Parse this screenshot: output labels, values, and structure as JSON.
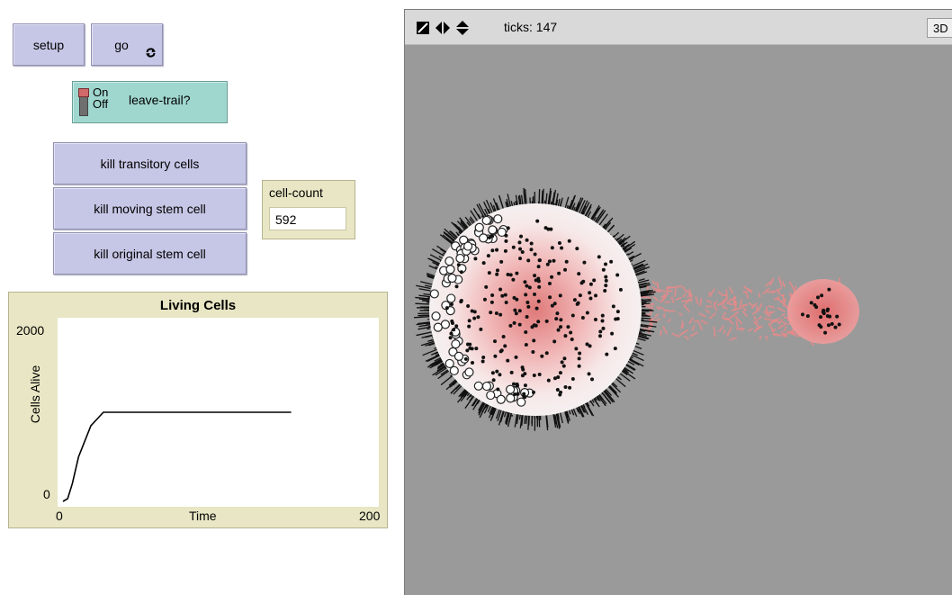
{
  "buttons": {
    "setup": "setup",
    "go": "go",
    "kill_transitory": "kill transitory cells",
    "kill_moving": "kill moving stem cell",
    "kill_original": "kill original stem cell"
  },
  "switch": {
    "name": "leave-trail?",
    "on_label": "On",
    "off_label": "Off",
    "state": "off"
  },
  "monitor": {
    "label": "cell-count",
    "value": "592"
  },
  "plot": {
    "title": "Living Cells",
    "y_top_label": "2000",
    "y_bottom_label": "0",
    "x_left_label": "0",
    "x_right_label": "200",
    "xlabel": "Time",
    "ylabel": "Cells Alive"
  },
  "chart_data": {
    "type": "line",
    "title": "Living Cells",
    "xlabel": "Time",
    "ylabel": "Cells Alive",
    "xlim": [
      0,
      200
    ],
    "ylim": [
      0,
      2000
    ],
    "series": [
      {
        "points": [
          [
            0,
            0
          ],
          [
            3,
            30
          ],
          [
            6,
            200
          ],
          [
            10,
            500
          ],
          [
            18,
            850
          ],
          [
            26,
            1000
          ],
          [
            147,
            1000
          ]
        ]
      }
    ]
  },
  "view": {
    "ticks_label": "ticks: 147",
    "three_d_label": "3D",
    "colors": {
      "background": "#9a9a9a",
      "toolbar": "#d9d9d9"
    }
  },
  "colors": {
    "button": "#c6c6e6",
    "switch": "#9fd6ce",
    "monitor": "#e8e6c4",
    "plot_frame": "#e8e6c4"
  }
}
